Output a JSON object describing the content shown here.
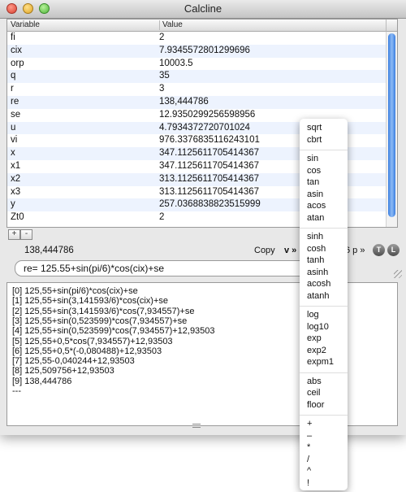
{
  "window": {
    "title": "Calcline"
  },
  "table": {
    "headers": {
      "variable": "Variable",
      "value": "Value"
    },
    "rows": [
      {
        "name": "fi",
        "value": "2"
      },
      {
        "name": "cix",
        "value": "7.9345572801299696"
      },
      {
        "name": "orp",
        "value": "10003.5"
      },
      {
        "name": "q",
        "value": "35"
      },
      {
        "name": "r",
        "value": "3"
      },
      {
        "name": "re",
        "value": "138,444786"
      },
      {
        "name": "se",
        "value": "12.9350299256598956"
      },
      {
        "name": "u",
        "value": "4.7934372720701024"
      },
      {
        "name": "vi",
        "value": "976.3376835116243101"
      },
      {
        "name": "x",
        "value": "347.1125611705414367"
      },
      {
        "name": "x1",
        "value": "347.1125611705414367"
      },
      {
        "name": "x2",
        "value": "313.1125611705414367"
      },
      {
        "name": "x3",
        "value": "313.1125611705414367"
      },
      {
        "name": "y",
        "value": "257.0368838823515999"
      },
      {
        "name": "Zt0",
        "value": "2"
      }
    ]
  },
  "controls": {
    "add_label": "+",
    "remove_label": "-",
    "result": "138,444786",
    "copy_label": "Copy",
    "v_menu_label": "v »",
    "precision_label": "6 p »",
    "t_label": "T",
    "l_label": "L"
  },
  "input": {
    "value": "re= 125.55+sin(pi/6)*cos(cix)+se"
  },
  "history": [
    "[0] 125,55+sin(pi/6)*cos(cix)+se",
    "[1] 125,55+sin(3,141593/6)*cos(cix)+se",
    "[2] 125,55+sin(3,141593/6)*cos(7,934557)+se",
    "[3] 125,55+sin(0,523599)*cos(7,934557)+se",
    "[4] 125,55+sin(0,523599)*cos(7,934557)+12,93503",
    "[5] 125,55+0,5*cos(7,934557)+12,93503",
    "[6] 125,55+0,5*(-0,080488)+12,93503",
    "[7] 125,55-0,040244+12,93503",
    "[8] 125,509756+12,93503",
    "[9] 138,444786",
    "---"
  ],
  "function_menu": {
    "groups": [
      [
        "sqrt",
        "cbrt"
      ],
      [
        "sin",
        "cos",
        "tan",
        "asin",
        "acos",
        "atan"
      ],
      [
        "sinh",
        "cosh",
        "tanh",
        "asinh",
        "acosh",
        "atanh"
      ],
      [
        "log",
        "log10",
        "exp",
        "exp2",
        "expm1"
      ],
      [
        "abs",
        "ceil",
        "floor"
      ],
      [
        "+",
        "–",
        "*",
        "/",
        "^",
        "!"
      ]
    ]
  }
}
